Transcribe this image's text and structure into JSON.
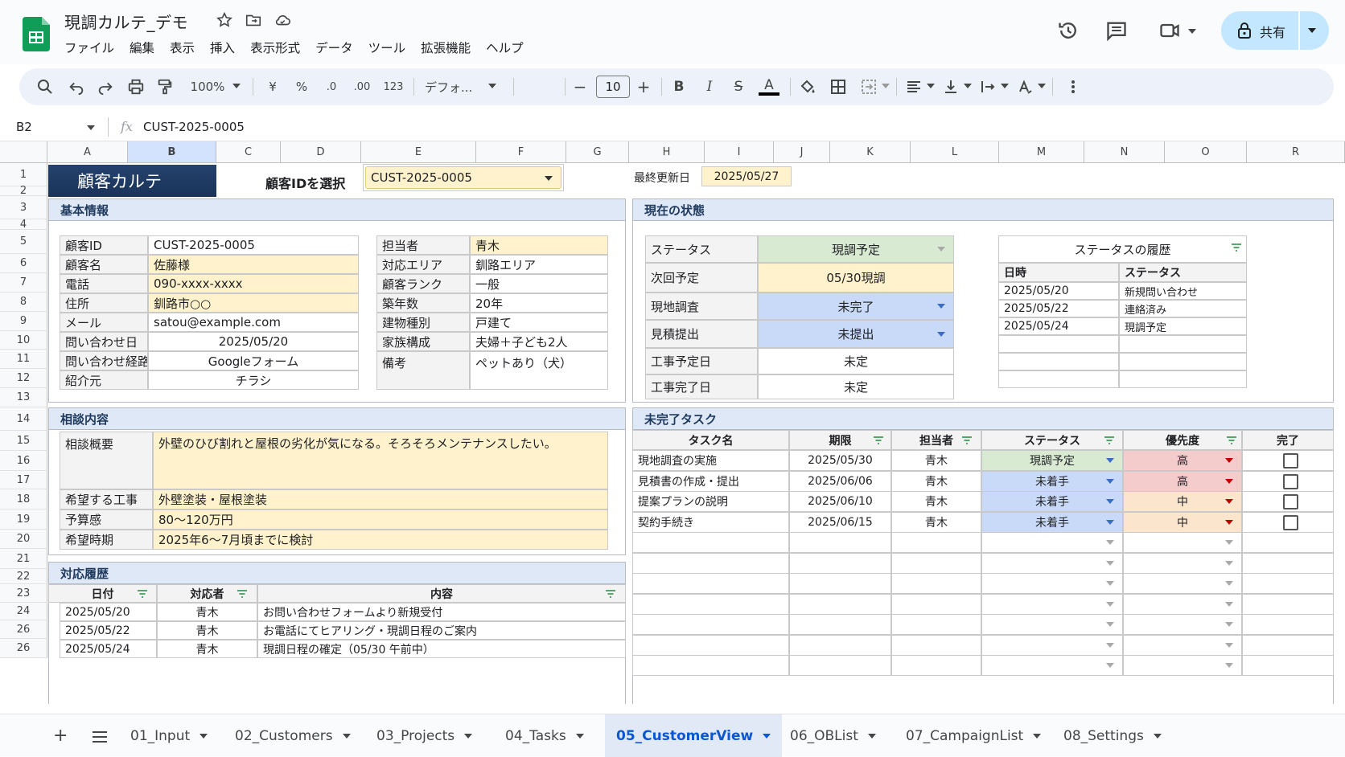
{
  "app": {
    "doc_title": "現調カルテ_デモ",
    "menu": [
      "ファイル",
      "編集",
      "表示",
      "挿入",
      "表示形式",
      "データ",
      "ツール",
      "拡張機能",
      "ヘルプ"
    ],
    "share_label": "共有"
  },
  "toolbar": {
    "zoom": "100%",
    "currency": "¥",
    "percent": "%",
    "dec_dec": ".0",
    "dec_inc": ".00",
    "number_format": "123",
    "font": "デフォ...",
    "font_size": "10"
  },
  "formula_bar": {
    "cell_ref": "B2",
    "fx": "fx",
    "value": "CUST-2025-0005"
  },
  "columns": [
    "A",
    "B",
    "C",
    "D",
    "E",
    "F",
    "G",
    "H",
    "I",
    "J",
    "K",
    "L",
    "M",
    "N",
    "O",
    "R"
  ],
  "rows": [
    "1",
    "2",
    "3",
    "4",
    "5",
    "6",
    "7",
    "8",
    "9",
    "10",
    "11",
    "12",
    "13",
    "14",
    "15",
    "16",
    "17",
    "18",
    "19",
    "20",
    "21",
    "22",
    "23",
    "24",
    "26",
    "26"
  ],
  "header": {
    "title": "顧客カルテ",
    "select_label": "顧客IDを選択",
    "select_value": "CUST-2025-0005",
    "updated_label": "最終更新日",
    "updated_value": "2025/05/27"
  },
  "basic_info": {
    "title": "基本情報",
    "left": [
      {
        "label": "顧客ID",
        "value": "CUST-2025-0005"
      },
      {
        "label": "顧客名",
        "value": "佐藤様"
      },
      {
        "label": "電話",
        "value": "090-xxxx-xxxx"
      },
      {
        "label": "住所",
        "value": "釧路市○○"
      },
      {
        "label": "メール",
        "value": "satou@example.com"
      },
      {
        "label": "問い合わせ日",
        "value": "2025/05/20"
      },
      {
        "label": "問い合わせ経路",
        "value": "Googleフォーム"
      },
      {
        "label": "紹介元",
        "value": "チラシ"
      }
    ],
    "right": [
      {
        "label": "担当者",
        "value": "青木"
      },
      {
        "label": "対応エリア",
        "value": "釧路エリア"
      },
      {
        "label": "顧客ランク",
        "value": "一般"
      },
      {
        "label": "築年数",
        "value": "20年"
      },
      {
        "label": "建物種別",
        "value": "戸建て"
      },
      {
        "label": "家族構成",
        "value": "夫婦＋子ども2人"
      },
      {
        "label": "備考",
        "value": "ペットあり（犬）"
      }
    ]
  },
  "status": {
    "title": "現在の状態",
    "items": [
      {
        "label": "ステータス",
        "value": "現調予定"
      },
      {
        "label": "次回予定",
        "value": "05/30現調"
      },
      {
        "label": "現地調査",
        "value": "未完了"
      },
      {
        "label": "見積提出",
        "value": "未提出"
      },
      {
        "label": "工事予定日",
        "value": "未定"
      },
      {
        "label": "工事完了日",
        "value": "未定"
      }
    ],
    "history_title": "ステータスの履歴",
    "history_headers": [
      "日時",
      "ステータス"
    ],
    "history": [
      {
        "date": "2025/05/20",
        "status": "新規問い合わせ"
      },
      {
        "date": "2025/05/22",
        "status": "連絡済み"
      },
      {
        "date": "2025/05/24",
        "status": "現調予定"
      }
    ]
  },
  "consult": {
    "title": "相談内容",
    "items": [
      {
        "label": "相談概要",
        "value": "外壁のひび割れと屋根の劣化が気になる。そろそろメンテナンスしたい。"
      },
      {
        "label": "希望する工事",
        "value": "外壁塗装・屋根塗装"
      },
      {
        "label": "予算感",
        "value": "80〜120万円"
      },
      {
        "label": "希望時期",
        "value": "2025年6〜7月頃までに検討"
      }
    ]
  },
  "history": {
    "title": "対応履歴",
    "headers": [
      "日付",
      "対応者",
      "内容"
    ],
    "rows": [
      {
        "date": "2025/05/20",
        "person": "青木",
        "content": "お問い合わせフォームより新規受付"
      },
      {
        "date": "2025/05/22",
        "person": "青木",
        "content": "お電話にてヒアリング・現調日程のご案内"
      },
      {
        "date": "2025/05/24",
        "person": "青木",
        "content": "現調日程の確定（05/30 午前中）"
      }
    ]
  },
  "tasks": {
    "title": "未完了タスク",
    "headers": [
      "タスク名",
      "期限",
      "担当者",
      "ステータス",
      "優先度",
      "完了"
    ],
    "rows": [
      {
        "name": "現地調査の実施",
        "due": "2025/05/30",
        "owner": "青木",
        "status": "現調予定",
        "priority": "高"
      },
      {
        "name": "見積書の作成・提出",
        "due": "2025/06/06",
        "owner": "青木",
        "status": "未着手",
        "priority": "高"
      },
      {
        "name": "提案プランの説明",
        "due": "2025/06/10",
        "owner": "青木",
        "status": "未着手",
        "priority": "中"
      },
      {
        "name": "契約手続き",
        "due": "2025/06/15",
        "owner": "青木",
        "status": "未着手",
        "priority": "中"
      }
    ]
  },
  "sheets": [
    "01_Input",
    "02_Customers",
    "03_Projects",
    "04_Tasks",
    "05_CustomerView",
    "06_OBList",
    "07_CampaignList",
    "08_Settings"
  ],
  "active_sheet": "05_CustomerView",
  "colors": {
    "accent": "#0b57d0",
    "header_dark": "#1f3a5f",
    "label_yellow": "#fff2cc",
    "section_blue": "#dfe8f6"
  }
}
